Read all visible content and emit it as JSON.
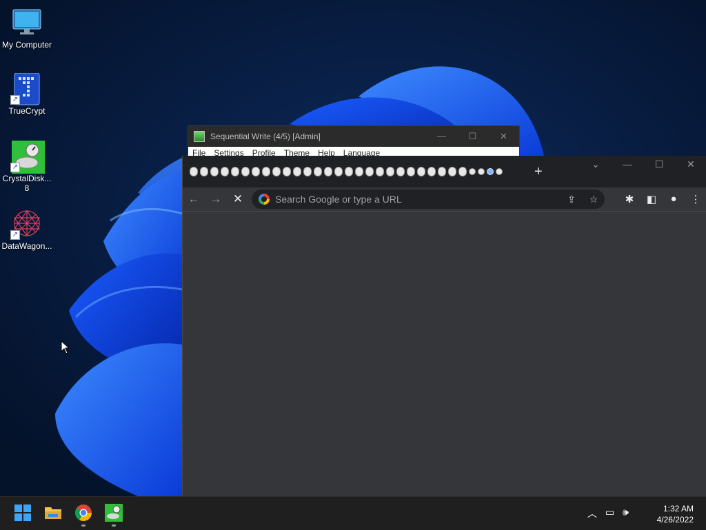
{
  "desktop": {
    "icons": [
      {
        "label": "My Computer",
        "icon": "monitor-icon"
      },
      {
        "label": "TrueCrypt",
        "icon": "truecrypt-icon"
      },
      {
        "label": "CrystalDisk...\n8",
        "label_line1": "CrystalDisk...",
        "label_line2": "8",
        "icon": "crystaldisk-icon"
      },
      {
        "label": "DataWagon...",
        "icon": "datawagon-icon"
      }
    ]
  },
  "cdm_window": {
    "title": "Sequential Write (4/5) [Admin]",
    "menu": [
      "File",
      "Settings",
      "Profile",
      "Theme",
      "Help",
      "Language"
    ]
  },
  "chrome": {
    "tab_count": 31,
    "new_tab": "+",
    "omnibox_placeholder": "Search Google or type a URL"
  },
  "taskbar": {
    "time": "1:32 AM",
    "date": "4/26/2022"
  },
  "colors": {
    "taskbar": "#1f1f1f",
    "chrome_frame": "#202124",
    "chrome_content": "#35363a",
    "accent_blue": "#8ab4f8"
  }
}
